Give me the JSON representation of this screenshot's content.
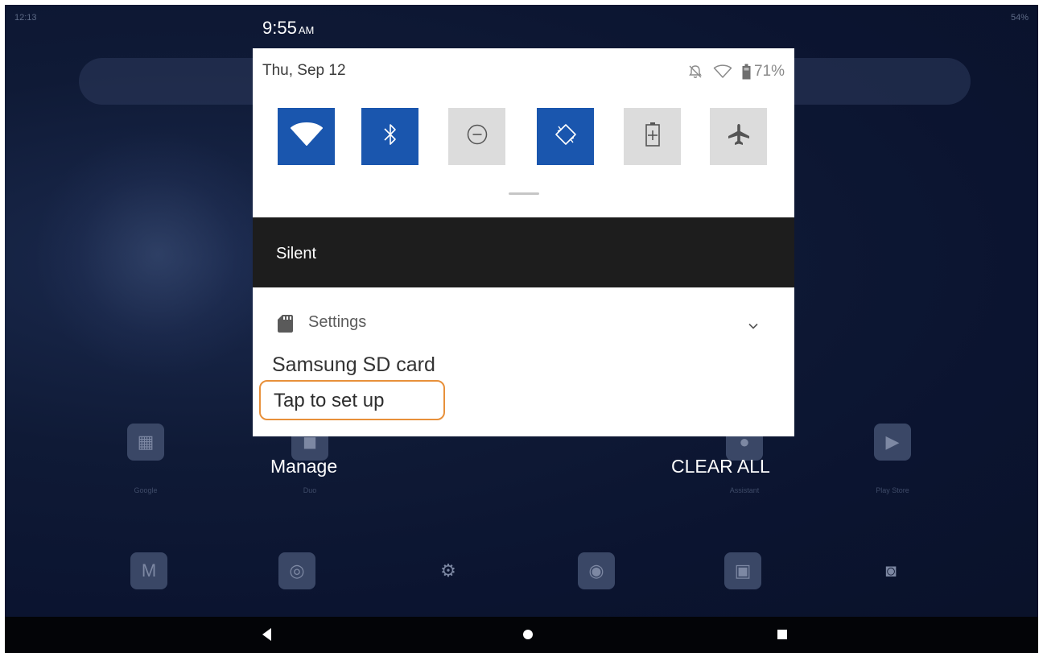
{
  "home": {
    "status_time": "12:13",
    "status_right": "54%",
    "apps": [
      {
        "name": "Google"
      },
      {
        "name": "Duo"
      },
      {
        "name": "Assistant"
      },
      {
        "name": "Play Store"
      }
    ]
  },
  "shade": {
    "time": "9:55",
    "time_suffix": "AM",
    "date": "Thu, Sep 12",
    "battery_text": "71%",
    "status_icons": [
      "bell-off-icon",
      "wifi-icon",
      "battery-icon"
    ],
    "quick_tiles": [
      {
        "name": "wifi",
        "icon": "wifi-icon",
        "active": true
      },
      {
        "name": "bluetooth",
        "icon": "bluetooth-icon",
        "active": true
      },
      {
        "name": "do-not-disturb",
        "icon": "do-not-disturb-icon",
        "active": false
      },
      {
        "name": "auto-rotate",
        "icon": "auto-rotate-icon",
        "active": true
      },
      {
        "name": "battery-saver",
        "icon": "battery-saver-icon",
        "active": false
      },
      {
        "name": "airplane-mode",
        "icon": "airplane-icon",
        "active": false
      }
    ],
    "section_header": "Silent",
    "notification": {
      "app_name": "Settings",
      "app_icon": "sd-card-icon",
      "title": "Samsung SD card",
      "text": "Tap to set up"
    },
    "manage_label": "Manage",
    "clear_all_label": "CLEAR ALL"
  },
  "colors": {
    "tile_active": "#1a56ae",
    "tile_inactive": "#dcdcdc",
    "silent_bar": "#1d1d1d",
    "highlight_outline": "#e8903a"
  }
}
